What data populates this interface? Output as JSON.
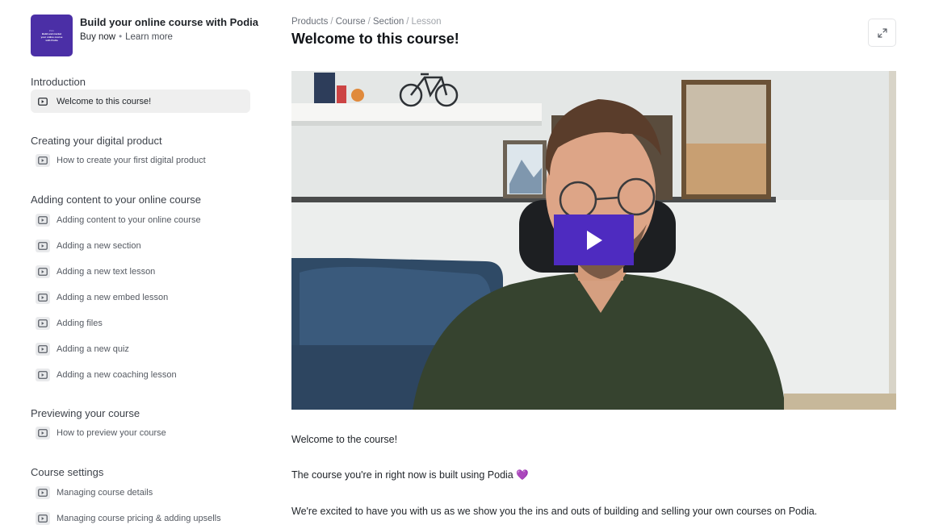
{
  "course": {
    "title": "Build your online course with Podia",
    "buy_now": "Buy now",
    "separator": "•",
    "learn_more": "Learn more",
    "thumbnail_text": [
      "Zoru",
      "Build and market",
      "your online course",
      "with Podia"
    ]
  },
  "sidebar": {
    "sections": [
      {
        "title": "Introduction",
        "lessons": [
          "Welcome to this course!"
        ]
      },
      {
        "title": "Creating your digital product",
        "lessons": [
          "How to create your first digital product"
        ]
      },
      {
        "title": "Adding content to your online course",
        "lessons": [
          "Adding content to your online course",
          "Adding a new section",
          "Adding a new text lesson",
          "Adding a new embed lesson",
          "Adding files",
          "Adding a new quiz",
          "Adding a new coaching lesson"
        ]
      },
      {
        "title": "Previewing your course",
        "lessons": [
          "How to preview your course"
        ]
      },
      {
        "title": "Course settings",
        "lessons": [
          "Managing course details",
          "Managing course pricing & adding upsells"
        ]
      }
    ],
    "active_lesson": "Welcome to this course!"
  },
  "breadcrumb": {
    "items": [
      "Products",
      "Course",
      "Section"
    ],
    "current": "Lesson",
    "separator": "/"
  },
  "page": {
    "title": "Welcome to this course!"
  },
  "icons": {
    "lesson": "video-lesson-icon",
    "expand": "expand-icon",
    "play": "play-icon"
  },
  "content": {
    "paragraphs": [
      "Welcome to the course!",
      "The course you're in right now is built using Podia",
      "We're excited to have you with us as we show you the ins and outs of building and selling your own courses on Podia."
    ],
    "heart_emoji": "💜"
  },
  "colors": {
    "play_button": "#4e2bc0",
    "thumbnail": "#4b2fa6",
    "active_lesson_bg": "#efefef"
  }
}
